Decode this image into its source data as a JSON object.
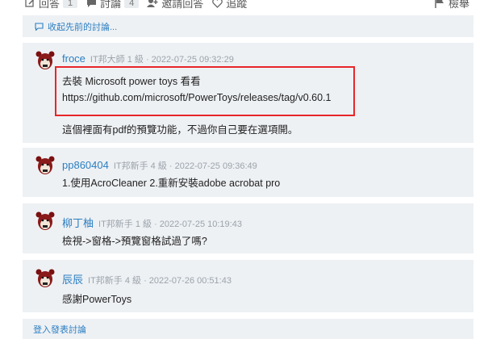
{
  "actions": {
    "reply_label": "回答",
    "reply_count": "1",
    "discuss_label": "討論",
    "discuss_count": "4",
    "invite_label": "邀請回答",
    "follow_label": "追蹤",
    "report_label": "檢舉"
  },
  "collapse_label": "收起先前的討論...",
  "comments": [
    {
      "user": "froce",
      "info": "IT邦大師 1 級 · 2022-07-25 09:32:29",
      "lines": [
        "去裝 Microsoft power toys 看看",
        "https://github.com/microsoft/PowerToys/releases/tag/v0.60.1",
        "",
        "這個裡面有pdf的預覽功能，不過你自己要在選項開。"
      ]
    },
    {
      "user": "pp860404",
      "info": "IT邦新手 4 級 · 2022-07-25 09:36:49",
      "lines": [
        "1.使用AcroCleaner 2.重新安裝adobe acrobat pro"
      ]
    },
    {
      "user": "柳丁柚",
      "info": "IT邦新手 1 級 · 2022-07-25 10:19:43",
      "lines": [
        "檢視->窗格->預覽窗格試過了嗎?"
      ]
    },
    {
      "user": "辰辰",
      "info": "IT邦新手 4 級 · 2022-07-26 00:51:43",
      "lines": [
        "感謝PowerToys"
      ]
    }
  ],
  "login_label": "登入發表討論",
  "colors": {
    "link": "#2b7ec1",
    "panel_bg": "#eef1f4",
    "highlight": "#e8262a",
    "meta": "#9aa3ab"
  }
}
